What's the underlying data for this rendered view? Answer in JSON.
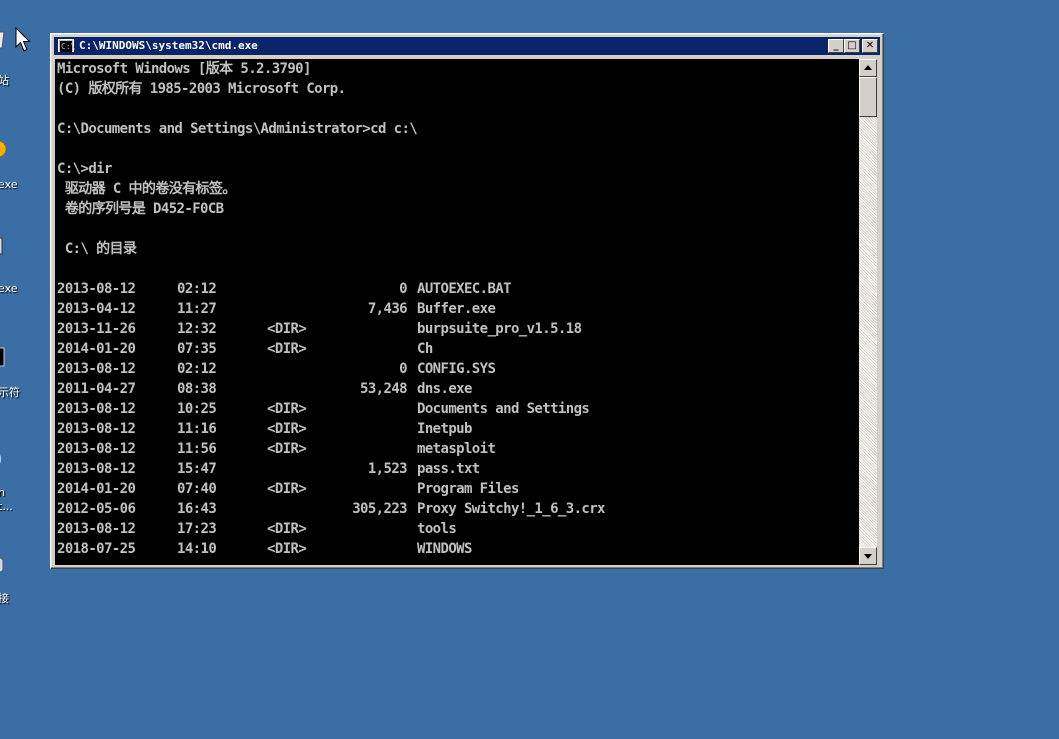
{
  "desktop": {
    "icons": [
      {
        "name": "recycle-bin-icon",
        "label": "站"
      },
      {
        "name": "app-exe-icon-1",
        "label": "exe"
      },
      {
        "name": "app-exe-icon-2",
        "label": "exe"
      },
      {
        "name": "command-prompt-shortcut-icon",
        "label": "示符"
      },
      {
        "name": "network-app-icon",
        "label": "n\nt..."
      },
      {
        "name": "connection-icon",
        "label": "接"
      }
    ]
  },
  "window": {
    "title": "C:\\WINDOWS\\system32\\cmd.exe",
    "icon_text": "C:\\",
    "buttons": {
      "minimize": "_",
      "maximize": "□",
      "close": "✕"
    }
  },
  "console": {
    "header_lines": [
      "Microsoft Windows [版本 5.2.3790]",
      "(C) 版权所有 1985-2003 Microsoft Corp.",
      "",
      "C:\\Documents and Settings\\Administrator>cd c:\\",
      "",
      "C:\\>dir",
      " 驱动器 C 中的卷没有标签。",
      " 卷的序列号是 D452-F0CB",
      "",
      " C:\\ 的目录",
      ""
    ],
    "entries": [
      {
        "date": "2013-08-12",
        "time": "02:12",
        "dir": "",
        "size": "0",
        "name": "AUTOEXEC.BAT"
      },
      {
        "date": "2013-04-12",
        "time": "11:27",
        "dir": "",
        "size": "7,436",
        "name": "Buffer.exe"
      },
      {
        "date": "2013-11-26",
        "time": "12:32",
        "dir": "<DIR>",
        "size": "",
        "name": "burpsuite_pro_v1.5.18"
      },
      {
        "date": "2014-01-20",
        "time": "07:35",
        "dir": "<DIR>",
        "size": "",
        "name": "Ch"
      },
      {
        "date": "2013-08-12",
        "time": "02:12",
        "dir": "",
        "size": "0",
        "name": "CONFIG.SYS"
      },
      {
        "date": "2011-04-27",
        "time": "08:38",
        "dir": "",
        "size": "53,248",
        "name": "dns.exe"
      },
      {
        "date": "2013-08-12",
        "time": "10:25",
        "dir": "<DIR>",
        "size": "",
        "name": "Documents and Settings"
      },
      {
        "date": "2013-08-12",
        "time": "11:16",
        "dir": "<DIR>",
        "size": "",
        "name": "Inetpub"
      },
      {
        "date": "2013-08-12",
        "time": "11:56",
        "dir": "<DIR>",
        "size": "",
        "name": "metasploit"
      },
      {
        "date": "2013-08-12",
        "time": "15:47",
        "dir": "",
        "size": "1,523",
        "name": "pass.txt"
      },
      {
        "date": "2014-01-20",
        "time": "07:40",
        "dir": "<DIR>",
        "size": "",
        "name": "Program Files"
      },
      {
        "date": "2012-05-06",
        "time": "16:43",
        "dir": "",
        "size": "305,223",
        "name": "Proxy Switchy!_1_6_3.crx"
      },
      {
        "date": "2013-08-12",
        "time": "17:23",
        "dir": "<DIR>",
        "size": "",
        "name": "tools"
      },
      {
        "date": "2018-07-25",
        "time": "14:10",
        "dir": "<DIR>",
        "size": "",
        "name": "WINDOWS"
      }
    ]
  },
  "colors": {
    "desktop": "#3a6ea5",
    "titlebar": "#0a246a",
    "console_bg": "#000000",
    "console_text": "#c0c0c0"
  }
}
